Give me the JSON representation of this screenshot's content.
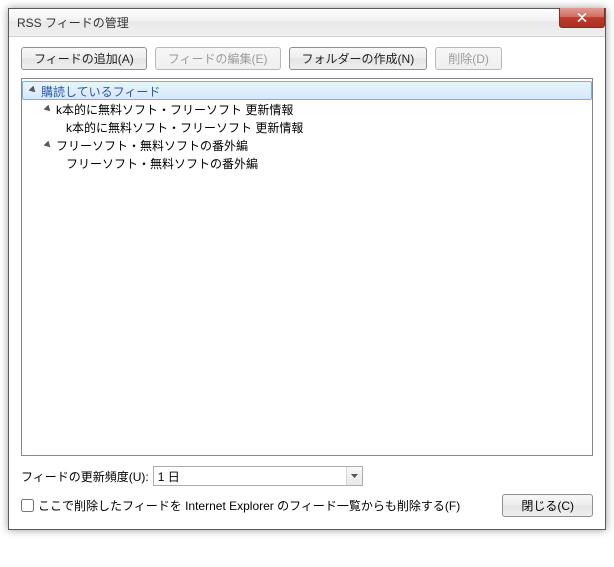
{
  "window": {
    "title": "RSS フィードの管理"
  },
  "toolbar": {
    "add_feed": "フィードの追加(A)",
    "edit_feed": "フィードの編集(E)",
    "create_folder": "フォルダーの作成(N)",
    "delete": "削除(D)"
  },
  "tree": {
    "root": {
      "label": "購読しているフィード",
      "expanded": true
    },
    "items": [
      {
        "label": "k本的に無料ソフト・フリーソフト 更新情報",
        "expanded": true,
        "children": [
          {
            "label": "k本的に無料ソフト・フリーソフト 更新情報"
          }
        ]
      },
      {
        "label": "フリーソフト・無料ソフトの番外編",
        "expanded": true,
        "children": [
          {
            "label": "フリーソフト・無料ソフトの番外編"
          }
        ]
      }
    ]
  },
  "frequency": {
    "label": "フィードの更新頻度(U):",
    "value": "1 日"
  },
  "ie_checkbox": {
    "label": "ここで削除したフィードを Internet Explorer のフィード一覧からも削除する(F)",
    "checked": false
  },
  "buttons": {
    "close": "閉じる(C)"
  }
}
